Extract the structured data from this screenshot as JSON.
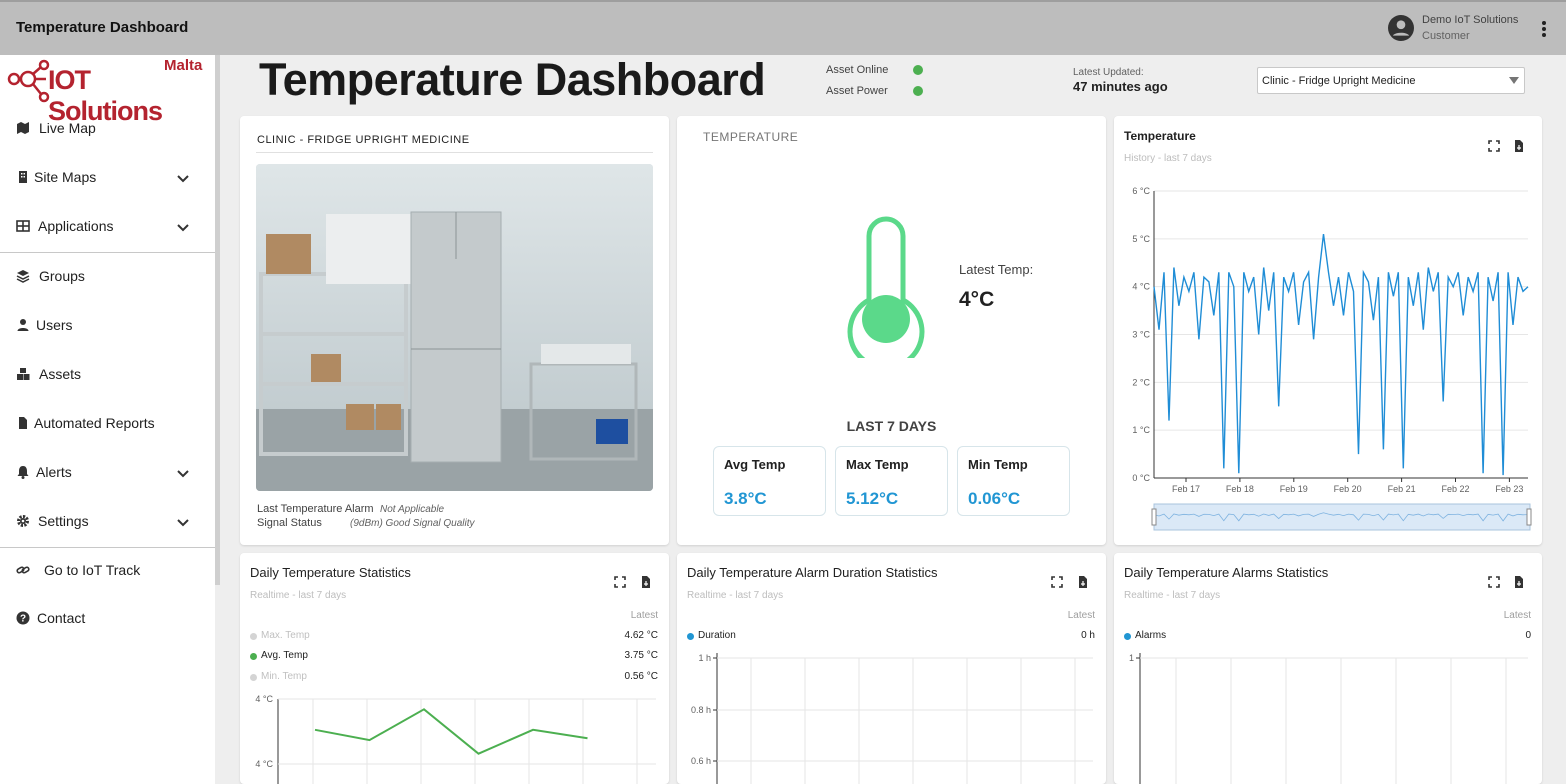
{
  "app": {
    "title": "Temperature Dashboard",
    "user_name": "Demo IoT Solutions",
    "user_role": "Customer"
  },
  "logo": {
    "brand": "IOT Solutions",
    "region": "Malta"
  },
  "sidebar": {
    "items": [
      {
        "label": "Live Map",
        "icon": "map-icon"
      },
      {
        "label": "Site Maps",
        "icon": "building-icon"
      },
      {
        "label": "Applications",
        "icon": "grid-icon"
      },
      {
        "label": "Groups",
        "icon": "layers-icon"
      },
      {
        "label": "Users",
        "icon": "person-icon"
      },
      {
        "label": "Assets",
        "icon": "cubes-icon"
      },
      {
        "label": "Automated Reports",
        "icon": "file-icon"
      },
      {
        "label": "Alerts",
        "icon": "bell-icon"
      },
      {
        "label": "Settings",
        "icon": "gear-icon"
      },
      {
        "label": "Go to IoT Track",
        "icon": "link-icon"
      },
      {
        "label": "Contact",
        "icon": "help-icon"
      }
    ]
  },
  "header": {
    "title": "Temperature Dashboard",
    "asset_online_label": "Asset Online",
    "asset_power_label": "Asset Power",
    "status_color": "#4caf50",
    "updated_label": "Latest Updated:",
    "updated_value": "47 minutes ago",
    "asset_select_value": "Clinic - Fridge Upright Medicine"
  },
  "asset_card": {
    "title": "CLINIC - FRIDGE UPRIGHT MEDICINE",
    "alarm_label": "Last Temperature Alarm",
    "alarm_value": "Not Applicable",
    "signal_label": "Signal Status",
    "signal_value": "(9dBm) Good Signal Quality"
  },
  "temp_card": {
    "title": "TEMPERATURE",
    "latest_label": "Latest Temp:",
    "latest_value": "4°C",
    "thermometer_color": "#5bd98a",
    "period_label": "LAST 7 DAYS",
    "stats": [
      {
        "label": "Avg Temp",
        "value": "3.8°C"
      },
      {
        "label": "Max Temp",
        "value": "5.12°C"
      },
      {
        "label": "Min Temp",
        "value": "0.06°C"
      }
    ],
    "value_color": "#2196d3"
  },
  "history_card": {
    "title": "Temperature",
    "subtitle": "History - last 7 days"
  },
  "daily_temp_card": {
    "title": "Daily Temperature Statistics",
    "subtitle": "Realtime - last 7 days",
    "latest_label": "Latest",
    "legend": [
      {
        "name": "Max. Temp",
        "value": "4.62 °C",
        "active": false
      },
      {
        "name": "Avg. Temp",
        "value": "3.75 °C",
        "active": true
      },
      {
        "name": "Min. Temp",
        "value": "0.56 °C",
        "active": false
      }
    ]
  },
  "alarm_duration_card": {
    "title": "Daily Temperature Alarm Duration Statistics",
    "subtitle": "Realtime - last 7 days",
    "latest_label": "Latest",
    "legend": [
      {
        "name": "Duration",
        "value": "0 h"
      }
    ]
  },
  "alarms_card": {
    "title": "Daily Temperature Alarms Statistics",
    "subtitle": "Realtime - last 7 days",
    "latest_label": "Latest",
    "legend": [
      {
        "name": "Alarms",
        "value": "0"
      }
    ]
  },
  "chart_data": [
    {
      "type": "line",
      "title": "Temperature",
      "subtitle": "History - last 7 days",
      "x_ticks": [
        "Feb 17",
        "Feb 18",
        "Feb 19",
        "Feb 20",
        "Feb 21",
        "Feb 22",
        "Feb 23"
      ],
      "y_ticks": [
        "0 °C",
        "1 °C",
        "2 °C",
        "3 °C",
        "4 °C",
        "5 °C",
        "6 °C"
      ],
      "ylim": [
        0,
        6
      ],
      "color": "#1f8dd6",
      "series": [
        {
          "values": [
            4.0,
            3.1,
            4.3,
            1.2,
            4.4,
            3.6,
            4.2,
            3.9,
            4.3,
            2.9,
            4.2,
            4.1,
            3.4,
            4.3,
            0.2,
            4.3,
            4.0,
            0.1,
            4.3,
            3.9,
            4.2,
            3.0,
            4.4,
            3.5,
            4.3,
            1.5,
            4.2,
            3.9,
            4.3,
            3.2,
            4.1,
            4.3,
            2.9,
            4.2,
            5.1,
            4.3,
            3.6,
            4.2,
            3.4,
            4.3,
            3.9,
            0.5,
            4.3,
            4.1,
            3.3,
            4.2,
            0.6,
            4.3,
            3.8,
            4.3,
            0.2,
            4.2,
            3.6,
            4.3,
            3.1,
            4.4,
            3.9,
            4.3,
            1.6,
            4.2,
            4.0,
            4.3,
            3.4,
            4.2,
            3.9,
            4.3,
            0.1,
            4.2,
            3.7,
            4.3,
            0.06,
            4.3,
            3.2,
            4.2,
            3.9,
            4.0
          ]
        }
      ],
      "grid": true
    },
    {
      "type": "line",
      "title": "Daily Temperature Statistics",
      "y_ticks": [
        "4 °C",
        "4 °C"
      ],
      "color": "#4caf50",
      "series": [
        {
          "name": "Avg. Temp",
          "values": [
            3.8,
            3.74,
            3.92,
            3.66,
            3.8,
            3.75
          ]
        }
      ],
      "grid": true
    },
    {
      "type": "bar",
      "title": "Daily Temperature Alarm Duration Statistics",
      "y_ticks": [
        "1 h",
        "0.8 h",
        "0.6 h"
      ],
      "series": [
        {
          "name": "Duration",
          "values": []
        }
      ],
      "grid": true
    },
    {
      "type": "bar",
      "title": "Daily Temperature Alarms Statistics",
      "y_ticks": [
        "1"
      ],
      "series": [
        {
          "name": "Alarms",
          "values": []
        }
      ],
      "grid": true
    }
  ]
}
